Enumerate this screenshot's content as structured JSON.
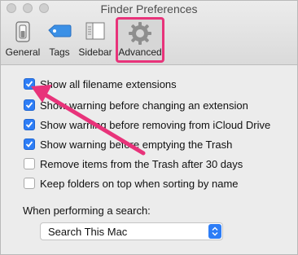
{
  "window": {
    "title": "Finder Preferences"
  },
  "toolbar": {
    "items": [
      {
        "label": "General"
      },
      {
        "label": "Tags"
      },
      {
        "label": "Sidebar"
      },
      {
        "label": "Advanced"
      }
    ]
  },
  "options": [
    {
      "label": "Show all filename extensions",
      "checked": true
    },
    {
      "label": "Show warning before changing an extension",
      "checked": true
    },
    {
      "label": "Show warning before removing from iCloud Drive",
      "checked": true
    },
    {
      "label": "Show warning before emptying the Trash",
      "checked": true
    },
    {
      "label": "Remove items from the Trash after 30 days",
      "checked": false
    },
    {
      "label": "Keep folders on top when sorting by name",
      "checked": false
    }
  ],
  "search": {
    "label": "When performing a search:",
    "selected": "Search This Mac"
  },
  "annotation": {
    "color": "#e8337a",
    "highlight_icon": "gear-icon"
  }
}
